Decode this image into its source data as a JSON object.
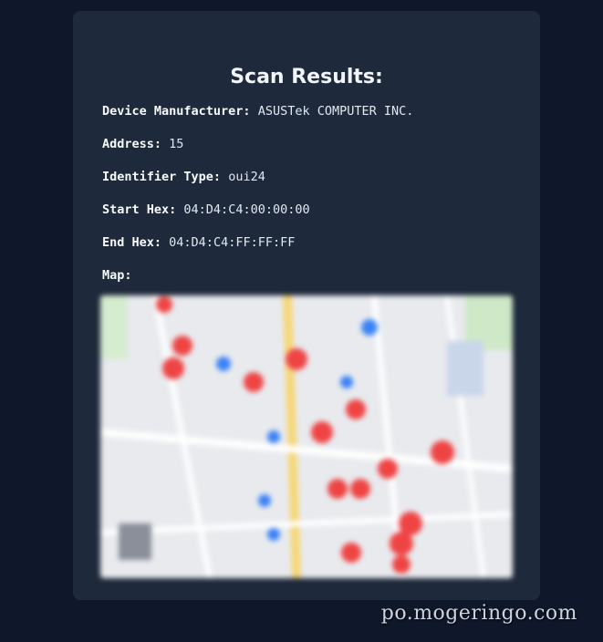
{
  "results": {
    "title": "Scan Results:",
    "manufacturer_label": "Device Manufacturer:",
    "manufacturer_value": "ASUSTek COMPUTER INC.",
    "address_label": "Address:",
    "address_value": "15",
    "identifier_label": "Identifier Type:",
    "identifier_value": "oui24",
    "start_label": "Start Hex:",
    "start_value": "04:D4:C4:00:00:00",
    "end_label": "End Hex:",
    "end_value": "04:D4:C4:FF:FF:FF",
    "map_label": "Map:"
  },
  "watermark": "po.mogeringo.com",
  "colors": {
    "page_bg": "#0f172a",
    "card_bg": "#1e293b",
    "map_marker": "#ef4444",
    "map_poi": "#3b82f6",
    "map_road": "#fbbf24"
  }
}
